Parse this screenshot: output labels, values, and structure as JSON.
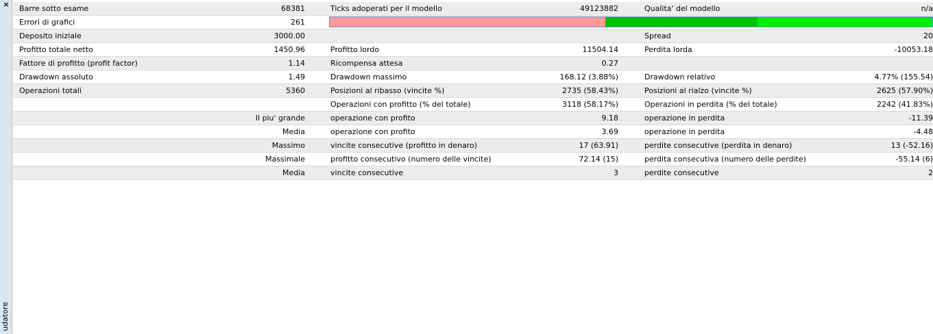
{
  "window": {
    "close_glyph": "×",
    "side_label": "udatore"
  },
  "quality_bar": {
    "segments": [
      {
        "fraction": 0.4574,
        "color": "#ff9999"
      },
      {
        "fraction": 0.252,
        "color": "#00c000"
      },
      {
        "fraction": 0.2906,
        "color": "#00ee00"
      }
    ]
  },
  "rows": [
    {
      "shade": "grey",
      "l1": "Barre sotto esame",
      "v1": "68381",
      "l2": "Ticks adoperati per il modello",
      "v2": "49123882",
      "l3": "Qualita' del modello",
      "v3": "n/a"
    },
    {
      "shade": "white",
      "l1": "Errori di grafici",
      "v1": "261",
      "l2": "",
      "v2": "",
      "l3": "",
      "v3": "",
      "bar": true
    },
    {
      "shade": "grey",
      "l1": "Deposito iniziale",
      "v1": "3000.00",
      "l2": "",
      "v2": "",
      "l3": "Spread",
      "v3": "20"
    },
    {
      "shade": "white",
      "l1": "Profitto totale netto",
      "v1": "1450.96",
      "l2": "Profitto lordo",
      "v2": "11504.14",
      "l3": "Perdita lorda",
      "v3": "-10053.18"
    },
    {
      "shade": "grey",
      "l1": "Fattore di profitto (profit factor)",
      "v1": "1.14",
      "l2": "Ricompensa attesa",
      "v2": "0.27",
      "l3": "",
      "v3": ""
    },
    {
      "shade": "white",
      "l1": "Drawdown assoluto",
      "v1": "1.49",
      "l2": "Drawdown massimo",
      "v2": "168.12 (3.88%)",
      "l3": "Drawdown relativo",
      "v3": "4.77% (155.54)"
    },
    {
      "shade": "grey",
      "l1": "Operazioni totali",
      "v1": "5360",
      "l2": "Posizioni al ribasso (vincite %)",
      "v2": "2735 (58.43%)",
      "l3": "Posizioni al rialzo (vincite %)",
      "v3": "2625 (57.90%)"
    },
    {
      "shade": "white",
      "l1": "",
      "v1": "",
      "l2": "Operazioni con profitto (% del totale)",
      "v2": "3118 (58.17%)",
      "l3": "Operazioni in perdita (% del totale)",
      "v3": "2242 (41.83%)"
    },
    {
      "shade": "grey",
      "l1": "",
      "v1": "Il piu' grande",
      "l2": "operazione con profito",
      "v2": "9.18",
      "l3": "operazione in perdita",
      "v3": "-11.39",
      "wide": true
    },
    {
      "shade": "white",
      "l1": "",
      "v1": "Media",
      "l2": "operazione con profito",
      "v2": "3.69",
      "l3": "operazione in perdita",
      "v3": "-4.48",
      "wide": true
    },
    {
      "shade": "grey",
      "l1": "",
      "v1": "Massimo",
      "l2": "vincite consecutive (profitto in denaro)",
      "v2": "17 (63.91)",
      "l3": "perdite consecutive (perdita in denaro)",
      "v3": "13 (-52.16)",
      "wide": true
    },
    {
      "shade": "white",
      "l1": "",
      "v1": "Massimale",
      "l2": "profitto consecutivo (numero delle vincite)",
      "v2": "72.14 (15)",
      "l3": "perdita consecutiva (numero delle perdite)",
      "v3": "-55.14 (6)",
      "wide": true
    },
    {
      "shade": "grey",
      "l1": "",
      "v1": "Media",
      "l2": "vincite consecutive",
      "v2": "3",
      "l3": "perdite consecutive",
      "v3": "2",
      "wide": true
    }
  ]
}
